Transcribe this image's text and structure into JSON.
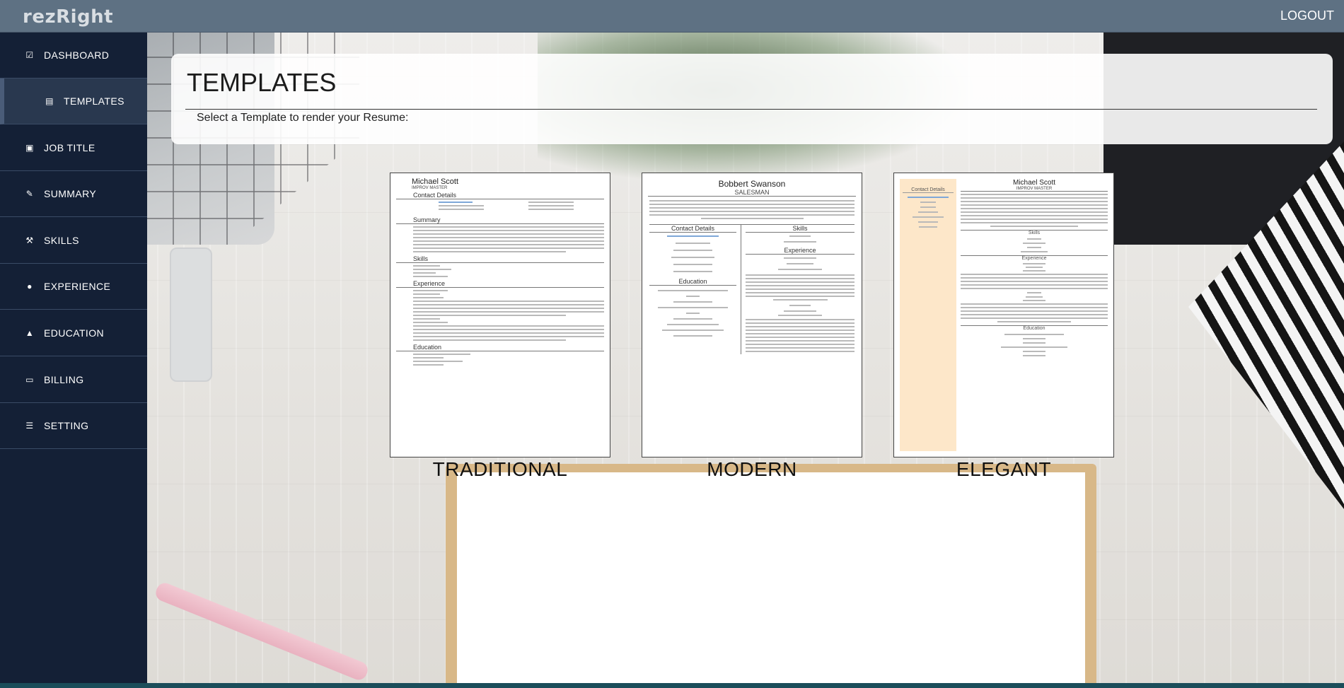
{
  "app": {
    "logo": "rezRight",
    "logout_label": "LOGOUT"
  },
  "sidebar": {
    "items": [
      {
        "label": "DASHBOARD",
        "icon": "check-square-icon"
      },
      {
        "label": "TEMPLATES",
        "icon": "file-icon",
        "active": true
      },
      {
        "label": "JOB TITLE",
        "icon": "briefcase-icon"
      },
      {
        "label": "SUMMARY",
        "icon": "edit-icon"
      },
      {
        "label": "SKILLS",
        "icon": "wrench-icon"
      },
      {
        "label": "EXPERIENCE",
        "icon": "lightbulb-icon"
      },
      {
        "label": "EDUCATION",
        "icon": "graduation-cap-icon"
      },
      {
        "label": "BILLING",
        "icon": "credit-card-icon"
      },
      {
        "label": "SETTING",
        "icon": "sliders-icon"
      }
    ]
  },
  "main": {
    "title": "TEMPLATES",
    "subtitle": "Select a Template to render your Resume:",
    "templates": [
      {
        "name": "TRADITIONAL",
        "preview": {
          "person": "Michael Scott",
          "role": "IMPROV MASTER",
          "sections": [
            "Contact Details",
            "Summary",
            "Skills",
            "Experience",
            "Education"
          ]
        }
      },
      {
        "name": "MODERN",
        "preview": {
          "person": "Bobbert Swanson",
          "role": "SALESMAN",
          "sections": [
            "Contact Details",
            "Skills",
            "Education",
            "Experience"
          ]
        }
      },
      {
        "name": "ELEGANT",
        "preview": {
          "person": "Michael Scott",
          "role": "IMPROV MASTER",
          "sections": [
            "Contact Details",
            "Skills",
            "Experience",
            "Education"
          ]
        }
      }
    ]
  },
  "colors": {
    "topbar": "#5e7183",
    "sidebar": "#142036",
    "sidebar_active": "#29384f",
    "elegant_sidebar": "#fde7c9"
  }
}
